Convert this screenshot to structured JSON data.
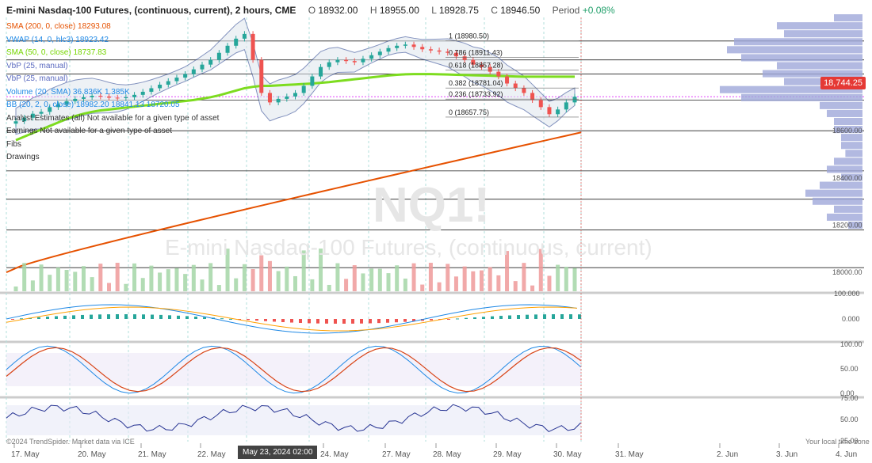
{
  "header": {
    "title": "E-mini Nasdaq-100 Futures, (continuous, current), 2 hours, CME",
    "o_label": "O",
    "o_value": "18932.00",
    "h_label": "H",
    "h_value": "18955.00",
    "l_label": "L",
    "l_value": "18928.75",
    "c_label": "C",
    "c_value": "18946.50",
    "period_label": "Period",
    "period_value": "+0.08%"
  },
  "legend": [
    {
      "text": "SMA (200, 0, close)  18293.08",
      "color": "#e65100"
    },
    {
      "text": "VWAP (14, 0, hlc3)  18923.42",
      "color": "#1e88e5"
    },
    {
      "text": "SMA (50, 0, close)  18737.83",
      "color": "#76d600"
    },
    {
      "text": "VbP (25, manual)",
      "color": "#5c6bc0"
    },
    {
      "text": "VbP (25, manual)",
      "color": "#5c6bc0"
    },
    {
      "text": "Volume (20, SMA)  36.836K  1.385K",
      "color": "#1e88e5"
    },
    {
      "text": "BB (20, 2, 0, close)  18982.20  18841.13  18720.05",
      "color": "#1e88e5"
    },
    {
      "text": "Analyst Estimates (all)   Not available for a given type of asset",
      "color": "#333"
    },
    {
      "text": "Earnings   Not available for a given type of asset",
      "color": "#333"
    },
    {
      "text": "Fibs",
      "color": "#333"
    },
    {
      "text": "Drawings",
      "color": "#333"
    }
  ],
  "watermark": {
    "symbol": "NQ1!",
    "name": "E-mini Nasdaq-100 Futures, (continuous, current)"
  },
  "current_price_tag": "18,744.25",
  "crosshair_time": "May 23, 2024 02:00",
  "copyright": "©2024 TrendSpider. Market data via ICE",
  "local_time": "Your local time zone",
  "colors": {
    "sma200": "#e65100",
    "sma50": "#7ddc1f",
    "bb": "#1e3a8a",
    "vwap": "#1e88e5",
    "up": "#26a69a",
    "down": "#ef5350",
    "vbp": "#9fa8da",
    "macd": "#1e88e5",
    "signal": "#ffa000",
    "stoch_k": "#1e88e5",
    "stoch_d": "#d84315",
    "rsi": "#283593"
  },
  "chart_data": {
    "type": "line",
    "x_ticks": [
      "17. May",
      "20. May",
      "21. May",
      "22. May",
      "24. May",
      "27. May",
      "28. May",
      "29. May",
      "30. May",
      "31. May",
      "2. Jun",
      "3. Jun",
      "4. Jun"
    ],
    "price_axis": {
      "ticks": [
        "18800.00",
        "18600.00",
        "18400.00",
        "18200.00",
        "18000.00"
      ],
      "range": [
        17920,
        19080
      ]
    },
    "fib": [
      {
        "level": "1",
        "value": "18980.50"
      },
      {
        "level": "0.786",
        "value": "18911.43"
      },
      {
        "level": "0.618",
        "value": "18857.28"
      },
      {
        "level": "0.382",
        "value": "18781.04"
      },
      {
        "level": "0.236",
        "value": "18733.92"
      },
      {
        "level": "0",
        "value": "18657.75"
      }
    ],
    "close": [
      18640,
      18655,
      18672,
      18680,
      18700,
      18712,
      18725,
      18735,
      18742,
      18748,
      18745,
      18740,
      18738,
      18742,
      18752,
      18765,
      18780,
      18795,
      18810,
      18825,
      18840,
      18860,
      18880,
      18900,
      18930,
      18960,
      18990,
      19010,
      18900,
      18760,
      18720,
      18735,
      18745,
      18760,
      18790,
      18830,
      18870,
      18890,
      18900,
      18895,
      18890,
      18905,
      18920,
      18935,
      18950,
      18960,
      18965,
      18955,
      18945,
      18940,
      18935,
      18930,
      18915,
      18900,
      18880,
      18870,
      18850,
      18830,
      18800,
      18780,
      18760,
      18730,
      18700,
      18670,
      18690,
      18720,
      18744
    ],
    "sma50": [
      18560,
      18575,
      18590,
      18605,
      18620,
      18635,
      18650,
      18662,
      18672,
      18680,
      18686,
      18690,
      18694,
      18698,
      18702,
      18706,
      18710,
      18714,
      18718,
      18722,
      18726,
      18730,
      18736,
      18742,
      18750,
      18760,
      18770,
      18780,
      18786,
      18790,
      18790,
      18792,
      18794,
      18796,
      18798,
      18800,
      18803,
      18806,
      18810,
      18814,
      18818,
      18822,
      18826,
      18830,
      18834,
      18837,
      18839,
      18840,
      18840,
      18840,
      18839,
      18838,
      18837,
      18836,
      18835,
      18834,
      18833,
      18832,
      18831,
      18830,
      18829,
      18829,
      18829,
      18829,
      18829,
      18829,
      18829
    ],
    "sma200": {
      "start": 18000,
      "end": 18593
    },
    "vbp_profile": [
      0.2,
      0.6,
      0.55,
      0.9,
      0.95,
      0.85,
      0.6,
      0.7,
      0.55,
      1.0,
      0.85,
      0.3,
      0.25,
      0.2,
      0.2,
      0.15,
      0.15,
      0.12,
      0.2,
      0.25,
      0.15,
      0.3,
      0.4,
      0.35,
      0.2,
      0.25,
      0.1
    ],
    "macd_axis": [
      "0.000"
    ],
    "stoch_axis": [
      "100.00",
      "50.00",
      "0.00"
    ],
    "rsi_axis": [
      "75.00",
      "50.00",
      "25.00"
    ],
    "volume_axis": [
      "100.000"
    ]
  }
}
